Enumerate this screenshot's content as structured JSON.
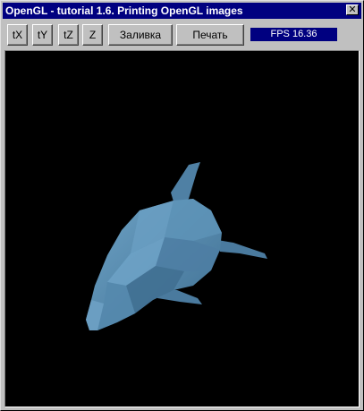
{
  "window": {
    "title": "OpenGL - tutorial 1.6. Printing OpenGL images",
    "close_glyph": "✕"
  },
  "toolbar": {
    "rotate_x_label": "tX",
    "rotate_y_label": "tY",
    "rotate_z_label": "tZ",
    "z_label": "Z",
    "fill_label": "Заливка",
    "print_label": "Печать"
  },
  "status": {
    "fps_text": "FPS 16.36"
  },
  "viewport": {
    "background": "#000000",
    "model_color": "#5a8db0",
    "subject": "dolphin"
  }
}
